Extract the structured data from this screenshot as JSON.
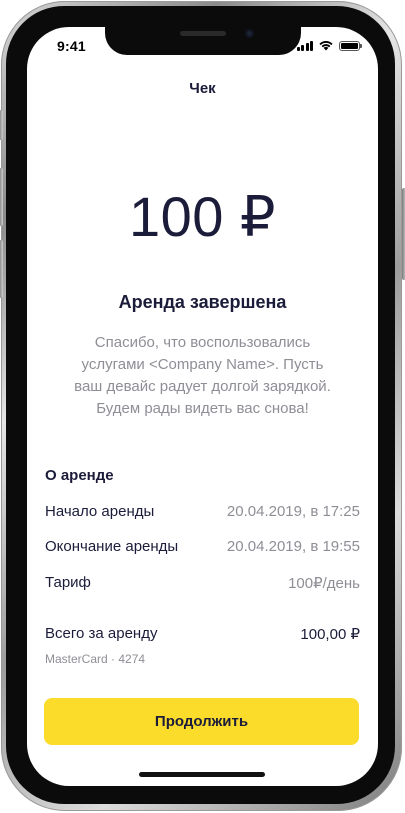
{
  "status_bar": {
    "time": "9:41"
  },
  "header": {
    "title": "Чек"
  },
  "receipt": {
    "amount": "100 ₽",
    "status": "Аренда завершена",
    "thanks_line1": "Спасибо, что воспользовались",
    "thanks_line2": "услугами <Company Name>. Пусть",
    "thanks_line3": "ваш девайс радует долгой зарядкой.",
    "thanks_line4": "Будем рады видеть вас снова!"
  },
  "rental_details": {
    "section_title": "О аренде",
    "rows": [
      {
        "label": "Начало аренды",
        "value": "20.04.2019, в 17:25"
      },
      {
        "label": "Окончание аренды",
        "value": "20.04.2019, в 19:55"
      },
      {
        "label": "Тариф",
        "value": "100₽/день"
      }
    ],
    "total_label": "Всего за аренду",
    "total_value": "100,00 ₽",
    "card_info": "MasterCard · 4274"
  },
  "actions": {
    "continue_label": "Продолжить"
  },
  "colors": {
    "accent": "#fcdc2b",
    "text_primary": "#1b1c3a",
    "text_secondary": "#8e8e96"
  }
}
